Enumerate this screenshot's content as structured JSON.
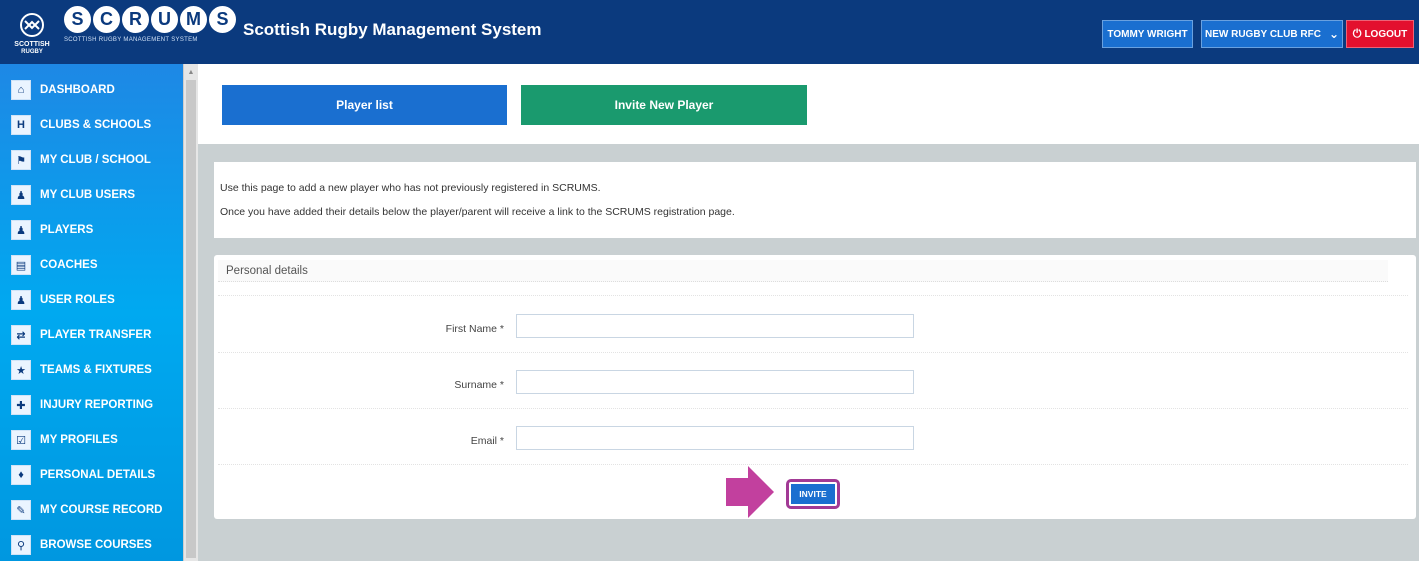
{
  "header": {
    "logo_letters": [
      "S",
      "C",
      "R",
      "U",
      "M",
      "S"
    ],
    "logo_subtitle": "SCOTTISH RUGBY MANAGEMENT SYSTEM",
    "crest_text_top": "SCOTTISH",
    "crest_text_bottom": "RUGBY",
    "title": "Scottish Rugby Management System",
    "user_button": "TOMMY WRIGHT",
    "club_button": "NEW RUGBY CLUB RFC",
    "logout_button": "LOGOUT"
  },
  "sidebar": {
    "items": [
      {
        "label": "DASHBOARD",
        "icon": "home-icon"
      },
      {
        "label": "CLUBS & SCHOOLS",
        "icon": "goalposts-icon"
      },
      {
        "label": "MY CLUB / SCHOOL",
        "icon": "club-icon"
      },
      {
        "label": "MY CLUB USERS",
        "icon": "users-icon"
      },
      {
        "label": "PLAYERS",
        "icon": "player-icon"
      },
      {
        "label": "COACHES",
        "icon": "clipboard-icon"
      },
      {
        "label": "USER ROLES",
        "icon": "roles-icon"
      },
      {
        "label": "PLAYER TRANSFER",
        "icon": "transfer-icon"
      },
      {
        "label": "TEAMS & FIXTURES",
        "icon": "trophy-icon"
      },
      {
        "label": "INJURY REPORTING",
        "icon": "injury-icon"
      },
      {
        "label": "MY PROFILES",
        "icon": "profiles-icon"
      },
      {
        "label": "PERSONAL DETAILS",
        "icon": "personal-icon"
      },
      {
        "label": "MY COURSE RECORD",
        "icon": "course-record-icon"
      },
      {
        "label": "BROWSE COURSES",
        "icon": "browse-icon"
      }
    ]
  },
  "tabs": {
    "player_list": "Player list",
    "invite_new_player": "Invite New Player"
  },
  "info": {
    "line1": "Use this page to add a new player who has not previously registered in SCRUMS.",
    "line2": "Once you have added their details below the player/parent will receive a link to the SCRUMS registration page."
  },
  "form": {
    "panel_title": "Personal details",
    "first_name_label": "First Name *",
    "surname_label": "Surname *",
    "email_label": "Email *",
    "first_name_value": "",
    "surname_value": "",
    "email_value": "",
    "invite_button": "INVITE"
  },
  "colors": {
    "header_bg": "#0b3a7e",
    "primary_blue": "#1a6fd0",
    "green": "#1a9a6e",
    "logout_red": "#e3102e",
    "highlight_magenta": "#c2409e"
  }
}
